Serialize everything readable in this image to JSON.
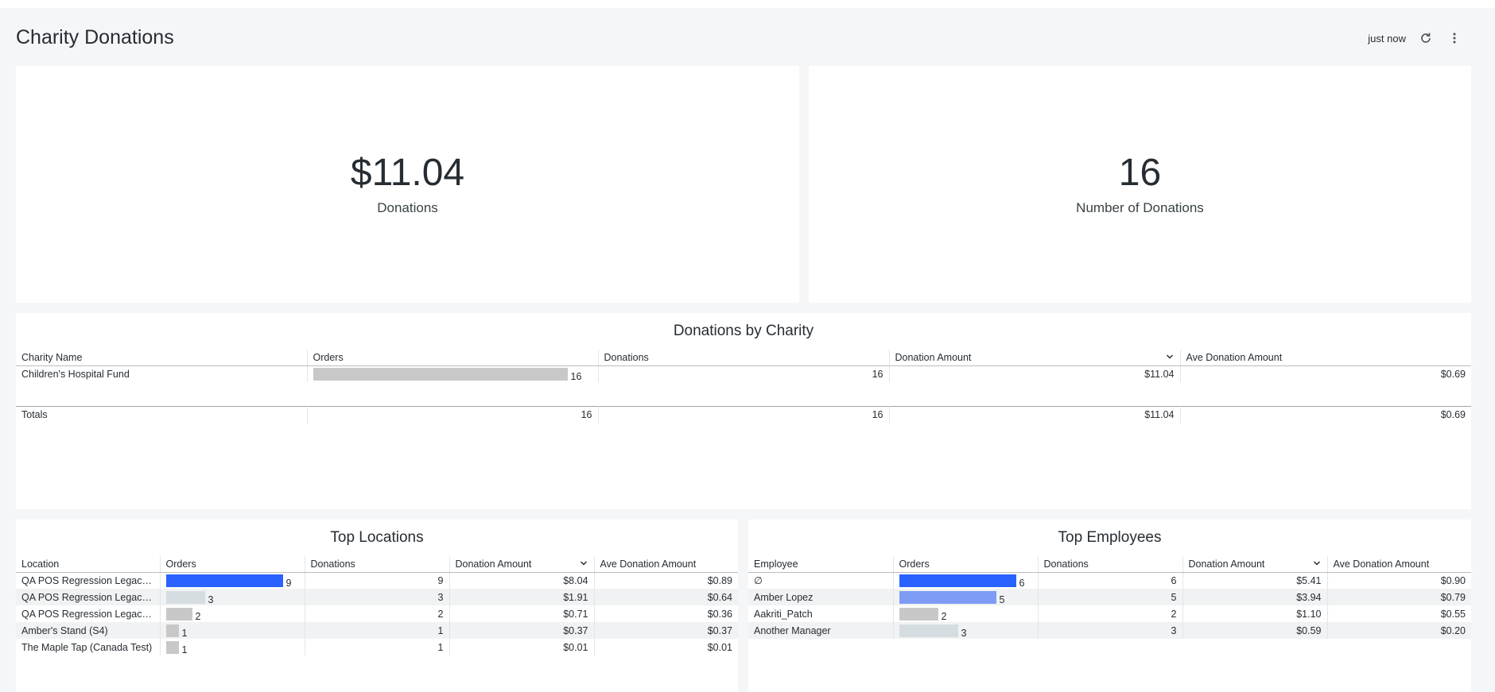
{
  "header": {
    "title": "Charity Donations",
    "timestamp": "just now",
    "refresh_icon": "refresh-icon",
    "menu_icon": "more-vertical-icon"
  },
  "kpis": [
    {
      "value": "$11.04",
      "label": "Donations"
    },
    {
      "value": "16",
      "label": "Number of Donations"
    }
  ],
  "by_charity": {
    "title": "Donations by Charity",
    "columns": [
      "Charity Name",
      "Orders",
      "Donations",
      "Donation Amount",
      "Ave Donation Amount"
    ],
    "rows": [
      {
        "name": "Children's Hospital Fund",
        "orders": "16",
        "orders_fraction": 1.0,
        "donations": "16",
        "amount": "$11.04",
        "avg": "$0.69"
      }
    ],
    "totals": {
      "label": "Totals",
      "orders": "16",
      "donations": "16",
      "amount": "$11.04",
      "avg": "$0.69"
    }
  },
  "top_locations": {
    "title": "Top Locations",
    "columns": [
      "Location",
      "Orders",
      "Donations",
      "Donation Amount",
      "Ave Donation Amount"
    ],
    "rows": [
      {
        "name": "QA POS Regression Legacy ...",
        "orders": "9",
        "orders_fraction": 1.0,
        "bar_color": "#2962ff",
        "donations": "9",
        "amount": "$8.04",
        "avg": "$0.89"
      },
      {
        "name": "QA POS Regression Legacy ...",
        "orders": "3",
        "orders_fraction": 0.333,
        "bar_color": "#d6dde0",
        "donations": "3",
        "amount": "$1.91",
        "avg": "$0.64"
      },
      {
        "name": "QA POS Regression Legacy ...",
        "orders": "2",
        "orders_fraction": 0.222,
        "bar_color": "#c8c8c8",
        "donations": "2",
        "amount": "$0.71",
        "avg": "$0.36"
      },
      {
        "name": "Amber's Stand (S4)",
        "orders": "1",
        "orders_fraction": 0.111,
        "bar_color": "#c8c8c8",
        "donations": "1",
        "amount": "$0.37",
        "avg": "$0.37"
      },
      {
        "name": "The Maple Tap (Canada Test)",
        "orders": "1",
        "orders_fraction": 0.111,
        "bar_color": "#c8c8c8",
        "donations": "1",
        "amount": "$0.01",
        "avg": "$0.01"
      }
    ]
  },
  "top_employees": {
    "title": "Top Employees",
    "columns": [
      "Employee",
      "Orders",
      "Donations",
      "Donation Amount",
      "Ave Donation Amount"
    ],
    "rows": [
      {
        "name": "∅",
        "orders": "6",
        "orders_fraction": 1.0,
        "bar_color": "#2962ff",
        "donations": "6",
        "amount": "$5.41",
        "avg": "$0.90"
      },
      {
        "name": "Amber Lopez",
        "orders": "5",
        "orders_fraction": 0.833,
        "bar_color": "#7f9cf5",
        "donations": "5",
        "amount": "$3.94",
        "avg": "$0.79"
      },
      {
        "name": "Aakriti_Patch",
        "orders": "2",
        "orders_fraction": 0.333,
        "bar_color": "#c8c8c8",
        "donations": "2",
        "amount": "$1.10",
        "avg": "$0.55"
      },
      {
        "name": "Another Manager",
        "orders": "3",
        "orders_fraction": 0.5,
        "bar_color": "#d6dde0",
        "donations": "3",
        "amount": "$0.59",
        "avg": "$0.20"
      }
    ]
  }
}
